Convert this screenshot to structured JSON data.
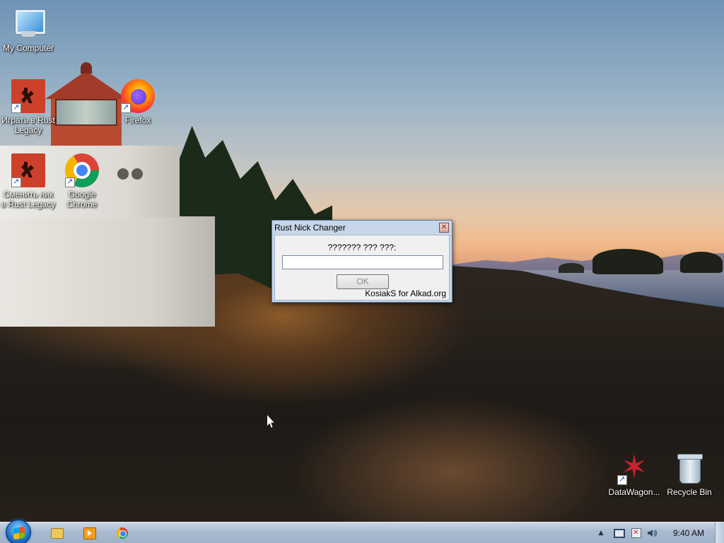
{
  "desktop": {
    "icons": [
      {
        "label": "My Computer",
        "icon": "computer-icon"
      },
      {
        "label": "Играть в Rust Legacy",
        "icon": "rust-icon"
      },
      {
        "label": "Firefox",
        "icon": "firefox-icon"
      },
      {
        "label": "Сменить ник в Rust Legacy",
        "icon": "rust-icon"
      },
      {
        "label": "Google Chrome",
        "icon": "chrome-icon"
      },
      {
        "label": "DataWagon...",
        "icon": "datawagon-icon"
      },
      {
        "label": "Recycle Bin",
        "icon": "recycle-bin-icon"
      }
    ]
  },
  "dialog": {
    "title": "Rust Nick Changer",
    "close_glyph": "✕",
    "prompt": "??????? ??? ???:",
    "input_value": "",
    "ok_label": "OK",
    "credit": "KosiakS for Alkad.org"
  },
  "taskbar": {
    "pinned": [
      "windows-explorer-icon",
      "media-player-icon",
      "chrome-icon"
    ],
    "tray": {
      "overflow_glyph": "▲",
      "icons": [
        "network-icon",
        "action-center-icon",
        "volume-icon"
      ],
      "clock": "9:40 AM"
    }
  },
  "colors": {
    "dialog_frame": "#c7d6e8",
    "taskbar": "#aabbd0",
    "rust_red": "#cd412b"
  }
}
